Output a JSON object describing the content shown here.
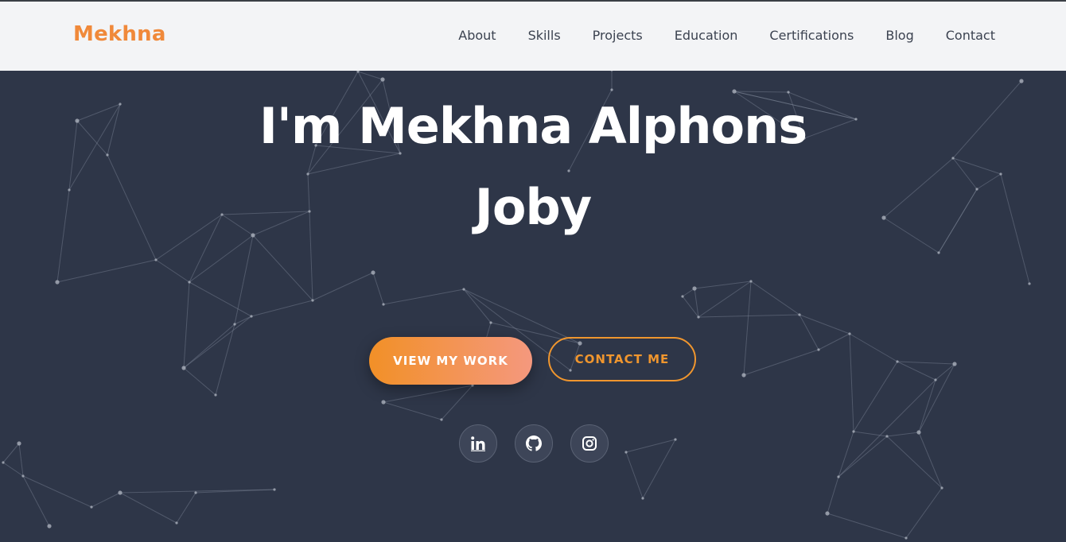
{
  "brand": {
    "name": "Mekhna"
  },
  "nav": {
    "items": [
      {
        "label": "About"
      },
      {
        "label": "Skills"
      },
      {
        "label": "Projects"
      },
      {
        "label": "Education"
      },
      {
        "label": "Certifications"
      },
      {
        "label": "Blog"
      },
      {
        "label": "Contact"
      }
    ]
  },
  "hero": {
    "title": "I'm Mekhna Alphons Joby",
    "primary_button": "VIEW MY WORK",
    "secondary_button": "CONTACT ME"
  },
  "social": {
    "icons": [
      "linkedin-icon",
      "github-icon",
      "instagram-icon"
    ]
  },
  "colors": {
    "accent": "#f0893a",
    "hero_background": "#2e3648",
    "navbar_background": "#f3f4f6",
    "nav_text": "#3b4250"
  }
}
